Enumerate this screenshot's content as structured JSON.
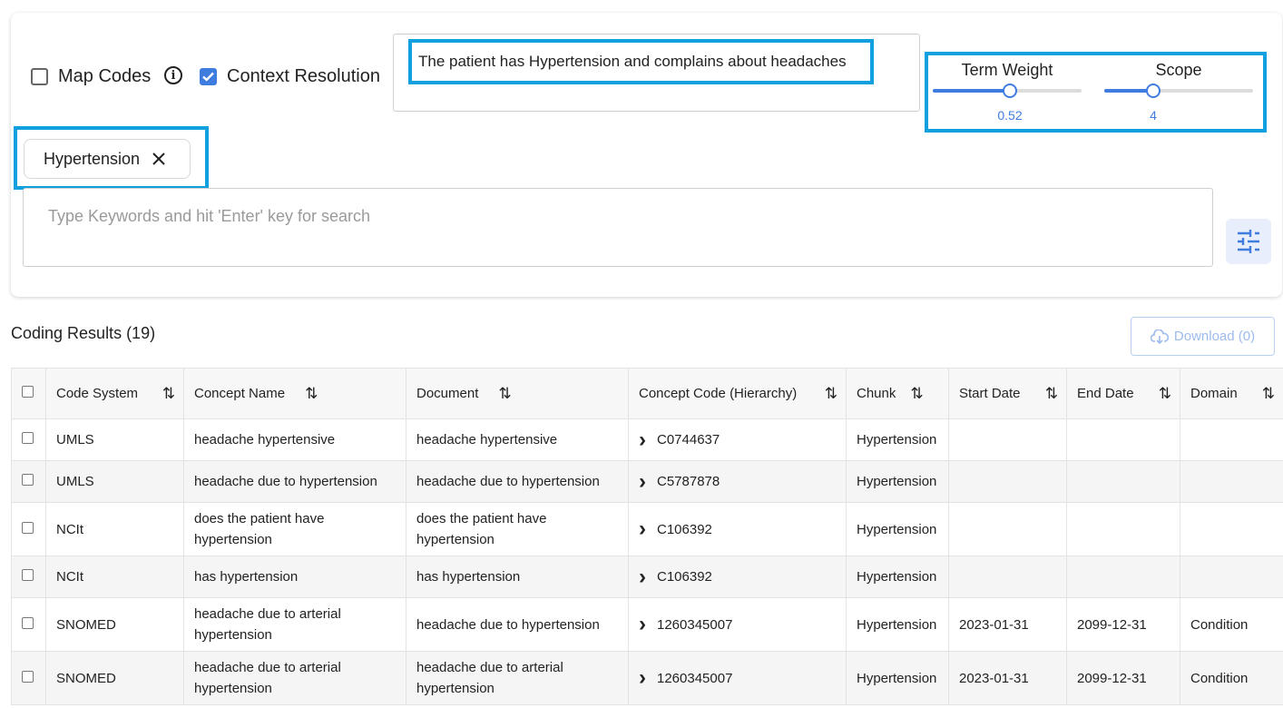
{
  "controls": {
    "map_codes_label": "Map Codes",
    "map_codes_checked": false,
    "context_resolution_label": "Context Resolution",
    "context_resolution_checked": true,
    "input_text": "The patient has Hypertension and complains about headaches"
  },
  "sliders": {
    "term_weight": {
      "label": "Term Weight",
      "value": "0.52",
      "fraction": 0.52
    },
    "scope": {
      "label": "Scope",
      "value": "4",
      "fraction": 0.33
    }
  },
  "chip": {
    "label": "Hypertension"
  },
  "search": {
    "placeholder": "Type Keywords and hit 'Enter' key for search"
  },
  "results": {
    "title": "Coding Results (19)",
    "download_label": "Download (0)"
  },
  "table": {
    "headers": [
      "Code System",
      "Concept Name",
      "Document",
      "Concept Code (Hierarchy)",
      "Chunk",
      "Start Date",
      "End Date",
      "Domain"
    ],
    "rows": [
      [
        "UMLS",
        "headache hypertensive",
        "headache hypertensive",
        "C0744637",
        "Hypertension",
        "",
        "",
        ""
      ],
      [
        "UMLS",
        "headache due to hypertension",
        "headache due to hypertension",
        "C5787878",
        "Hypertension",
        "",
        "",
        ""
      ],
      [
        "NCIt",
        "does the patient have hypertension",
        "does the patient have hypertension",
        "C106392",
        "Hypertension",
        "",
        "",
        ""
      ],
      [
        "NCIt",
        "has hypertension",
        "has hypertension",
        "C106392",
        "Hypertension",
        "",
        "",
        ""
      ],
      [
        "SNOMED",
        "headache due to arterial hypertension",
        "headache due to hypertension",
        "1260345007",
        "Hypertension",
        "2023-01-31",
        "2099-12-31",
        "Condition"
      ],
      [
        "SNOMED",
        "headache due to arterial hypertension",
        "headache due to arterial hypertension",
        "1260345007",
        "Hypertension",
        "2023-01-31",
        "2099-12-31",
        "Condition"
      ]
    ]
  },
  "colors": {
    "accent": "#3f7ce0",
    "highlight": "#10a0e0"
  }
}
